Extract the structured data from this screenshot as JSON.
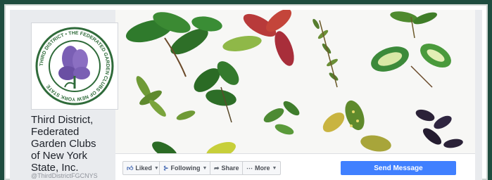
{
  "page": {
    "name_lines": [
      "Third District,",
      "Federated",
      "Garden Clubs",
      "of New York",
      "State, Inc."
    ],
    "handle": "@ThirdDistrictFGCNYS"
  },
  "logo": {
    "ring_text": "THIRD DISTRICT • THE FEDERATED GARDEN CLUBS OF NEW YORK STATE",
    "ring_color": "#2f6b3a",
    "flower_color": "#7a5fb4"
  },
  "actions": {
    "liked": "Liked",
    "following": "Following",
    "share": "Share",
    "more": "More",
    "send_message": "Send Message"
  },
  "colors": {
    "background": "#1f4d3f",
    "accent": "#4080ff",
    "fb_blue": "#4267b2"
  },
  "icons": {
    "liked": "thumbs-up-icon",
    "following": "rss-icon",
    "share": "share-arrow-icon",
    "more": "ellipsis-icon"
  }
}
